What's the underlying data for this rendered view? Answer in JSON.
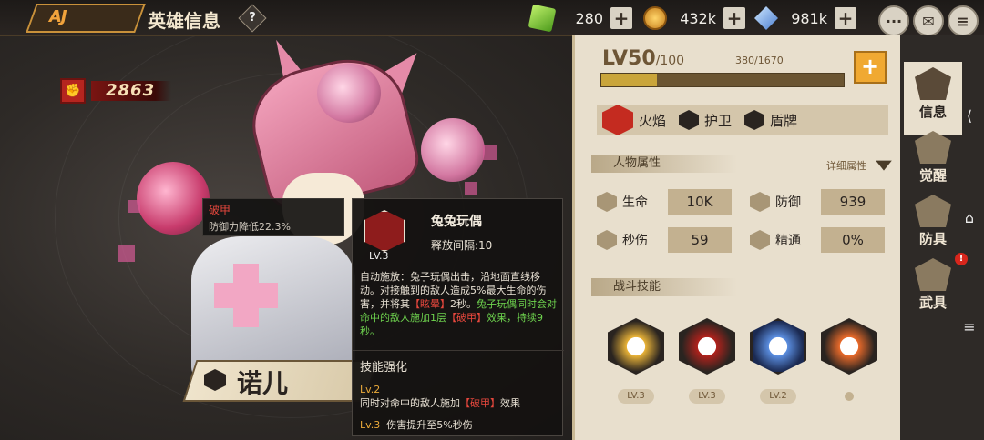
{
  "header": {
    "title": "英雄信息",
    "help_icon": "?",
    "back_logo": "AJ"
  },
  "resources": [
    {
      "icon": "gem-icon",
      "value": "280",
      "plus": "+"
    },
    {
      "icon": "coin-icon",
      "value": "432k",
      "plus": "+"
    },
    {
      "icon": "crystal-icon",
      "value": "981k",
      "plus": "+"
    }
  ],
  "top_icons": [
    "chat-icon",
    "mail-icon",
    "menu-icon"
  ],
  "power": {
    "value": "2863"
  },
  "hero": {
    "name": "诺儿"
  },
  "debuff_tooltip": {
    "title": "破甲",
    "text": "防御力降低22.3%"
  },
  "skill_tooltip": {
    "level": "LV.3",
    "name": "兔兔玩偶",
    "cooldown": "释放间隔:10",
    "desc_pre": "自动施放：兔子玩偶出击，沿地面直线移动。对接触到的敌人造成5%最大生命的伤害，并将其",
    "desc_stun": "【眩晕】",
    "desc_post": "2秒。",
    "desc_green": "兔子玩偶同时会对命中的敌人施加1层",
    "desc_break": "【破甲】",
    "desc_green_end": "效果，持续9秒。",
    "enhance_title": "技能强化",
    "enh2_lv": "Lv.2",
    "enh2_pre": "同时对命中的敌人施加",
    "enh2_break": "【破甲】",
    "enh2_post": "效果",
    "enh3_lv": "Lv.3",
    "enh3_text": "伤害提升至5%秒伤"
  },
  "level": {
    "label": "LV50",
    "max": "/100",
    "exp": "380/1670",
    "progress": 0.23,
    "plus": "+"
  },
  "tags": [
    "火焰",
    "护卫",
    "盾牌"
  ],
  "attributes": {
    "section_title": "人物属性",
    "detail_link": "详细属性",
    "items": [
      {
        "name": "生命",
        "value": "10K"
      },
      {
        "name": "防御",
        "value": "939"
      },
      {
        "name": "秒伤",
        "value": "59"
      },
      {
        "name": "精通",
        "value": "0%"
      }
    ]
  },
  "skills": {
    "section_title": "战斗技能",
    "items": [
      {
        "level": "LV.3"
      },
      {
        "level": "LV.3"
      },
      {
        "level": "LV.2"
      },
      {
        "level": ""
      }
    ]
  },
  "side_tabs": [
    {
      "label": "信息",
      "active": true
    },
    {
      "label": "觉醒",
      "active": false
    },
    {
      "label": "防具",
      "active": false
    },
    {
      "label": "武具",
      "active": false,
      "badge": "!"
    }
  ],
  "colors": {
    "accent": "#f0a932",
    "panel_bg": "#e8dfcd",
    "dark_bg": "#2b2725",
    "debuff_red": "#e5473d",
    "effect_green": "#6ed34e"
  }
}
